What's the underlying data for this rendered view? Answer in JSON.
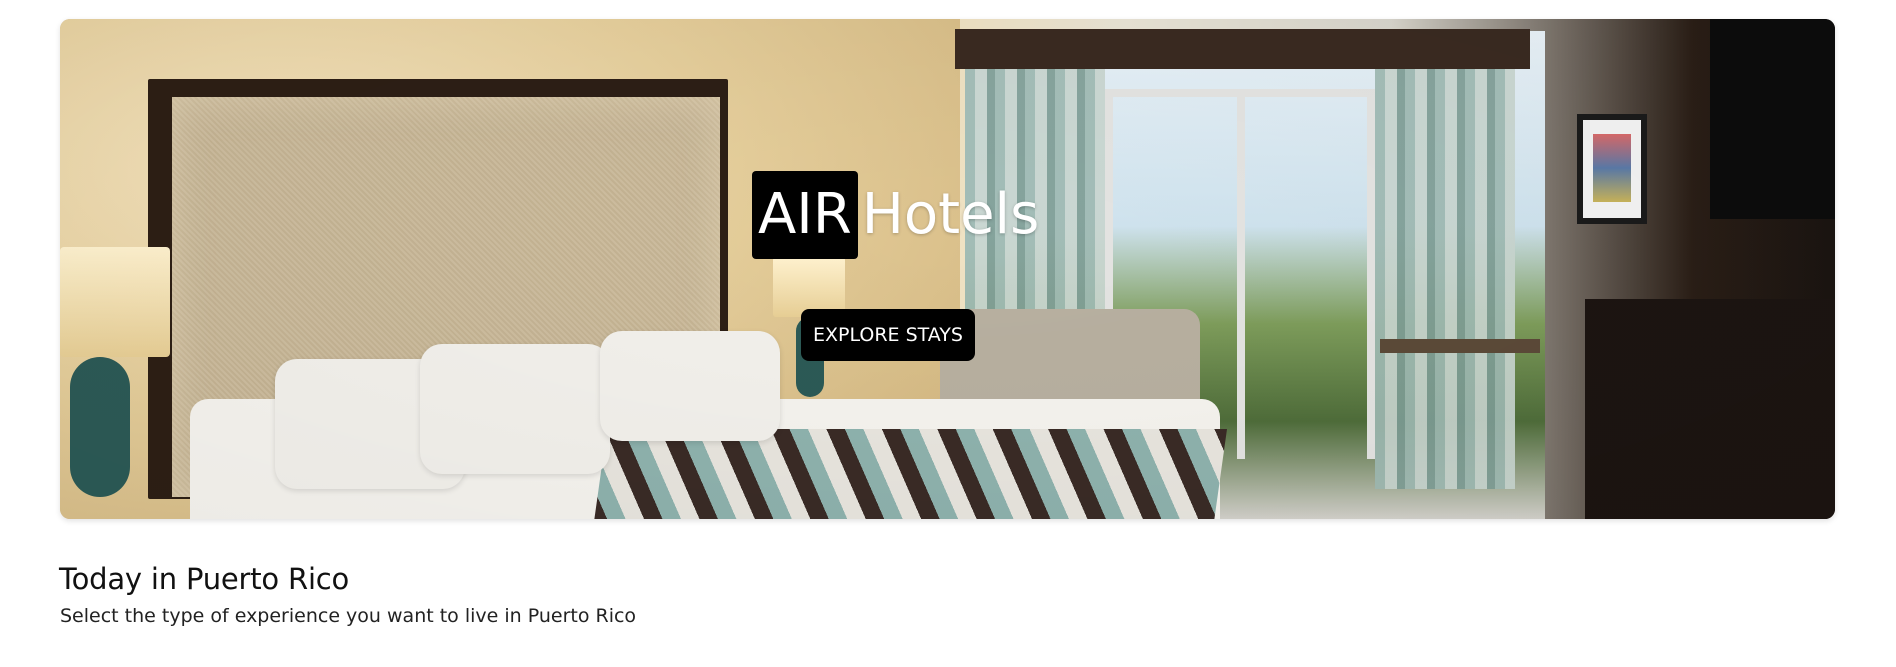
{
  "hero": {
    "brand_highlight": "AIR",
    "brand_rest": "Hotels",
    "cta_label": "EXPLORE STAYS",
    "image_alt": "hotel-room-photo"
  },
  "section": {
    "title": "Today in Puerto Rico",
    "subtitle": "Select the type of experience you want to live in Puerto Rico"
  },
  "colors": {
    "brand_box": "#000000",
    "cta_background": "#000000",
    "cta_text": "#ffffff",
    "page_background": "#ffffff",
    "heading_text": "#111111"
  },
  "icons": {
    "hero_image": "hotel-room-image"
  }
}
